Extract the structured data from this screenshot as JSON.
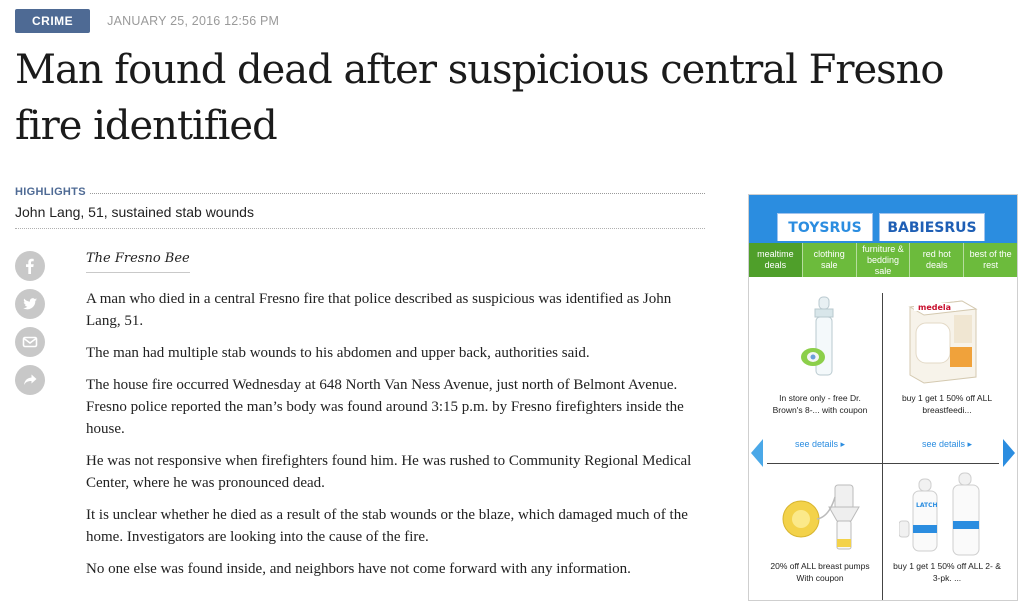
{
  "meta": {
    "section": "CRIME",
    "timestamp": "JANUARY 25, 2016 12:56 PM"
  },
  "headline": "Man found dead after suspicious central Fresno fire identified",
  "highlights": {
    "label": "HIGHLIGHTS",
    "items": [
      "John Lang, 51, sustained stab wounds"
    ]
  },
  "share_icons": [
    "facebook-icon",
    "twitter-icon",
    "email-icon",
    "share-icon"
  ],
  "byline": "The Fresno Bee",
  "article": {
    "paragraphs": [
      "A man who died in a central Fresno fire that police described as suspicious was identified as John Lang, 51.",
      "The man had multiple stab wounds to his abdomen and upper back, authorities said.",
      "The house fire occurred Wednesday at 648 North Van Ness Avenue, just north of Belmont Avenue. Fresno police reported the man’s body was found around 3:15 p.m. by Fresno firefighters inside the house.",
      "He was not responsive when firefighters found him. He was rushed to Community Regional Medical Center, where he was pronounced dead.",
      "It is unclear whether he died as a result of the stab wounds or the blaze, which damaged much of the home. Investigators are looking into the cause of the fire.",
      "No one else was found inside, and neighbors have not come forward with any information."
    ]
  },
  "ad": {
    "logos": [
      "TOYSRUS",
      "BABIESRUS"
    ],
    "nav": [
      "mealtime deals",
      "clothing sale",
      "furniture & bedding sale",
      "red hot deals",
      "best of the rest"
    ],
    "products": [
      {
        "caption": "In store only - free Dr. Brown's 8-... with coupon",
        "link": "see details ▸"
      },
      {
        "caption": "buy 1 get 1 50% off ALL breastfeedi...",
        "link": "see details ▸"
      },
      {
        "caption": "20% off ALL breast pumps With coupon",
        "link": ""
      },
      {
        "caption": "buy 1 get 1 50% off ALL 2- & 3-pk. ...",
        "link": ""
      }
    ],
    "product_labels": {
      "medela": "medela",
      "latch": "LATCH"
    },
    "colors": {
      "blue": "#2b8de0",
      "green": "#6cbb3c"
    }
  }
}
